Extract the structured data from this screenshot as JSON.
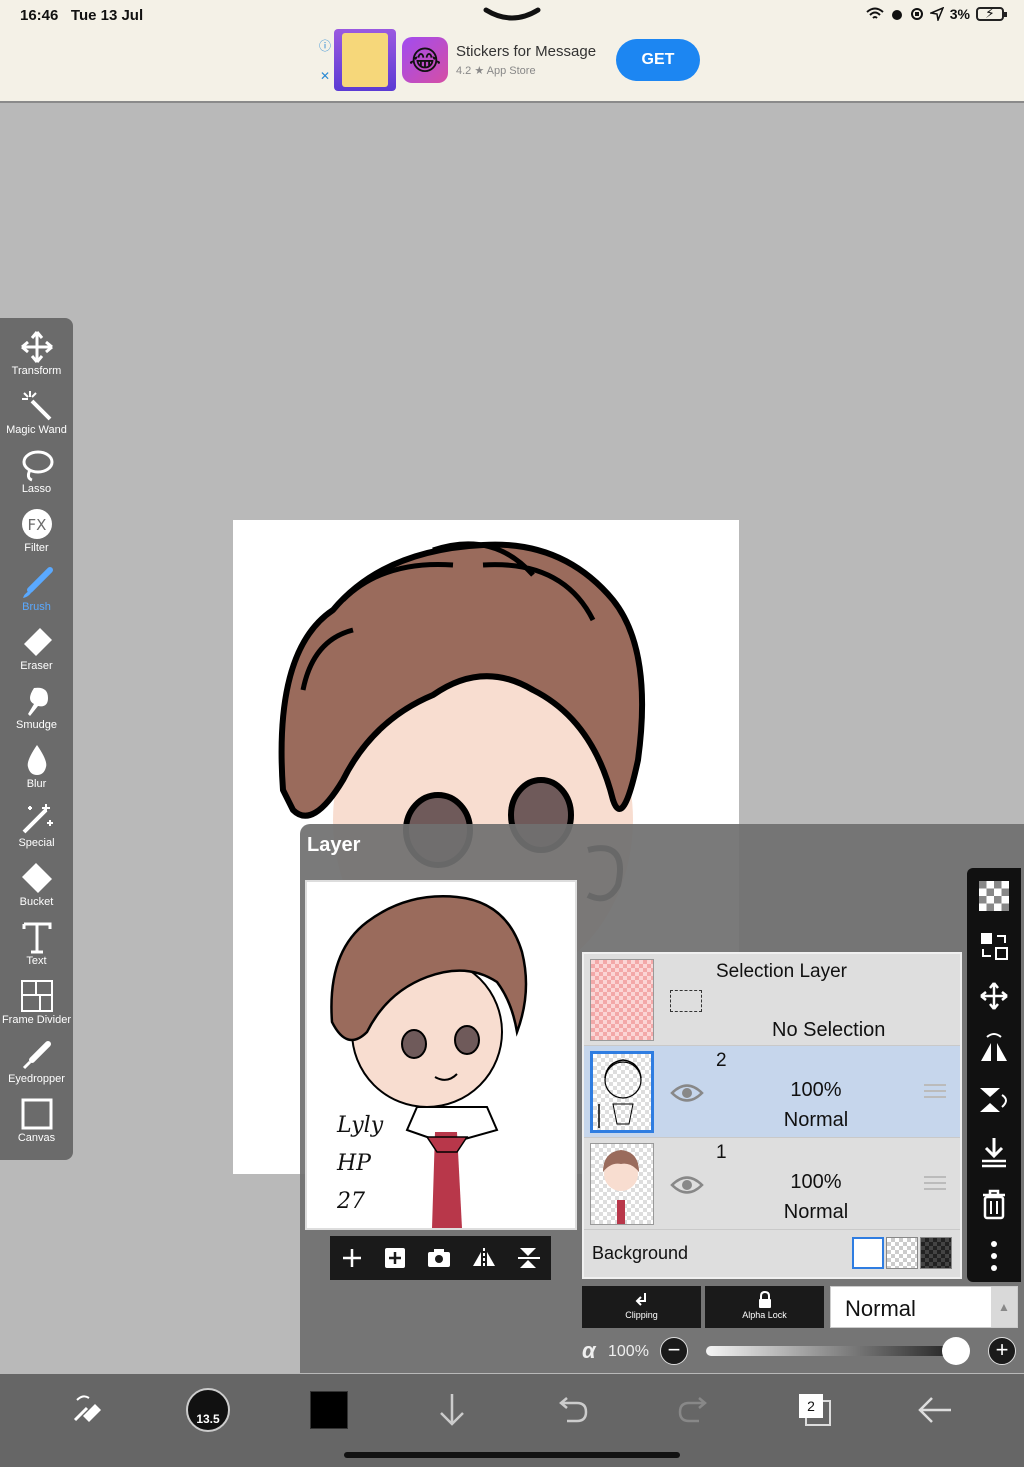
{
  "status": {
    "time": "16:46",
    "date": "Tue 13 Jul",
    "battery": "3%"
  },
  "ad": {
    "title": "Stickers for Message",
    "subtitle": "4.2 ★ App Store",
    "cta": "GET"
  },
  "tools": [
    {
      "id": "transform",
      "label": "Transform",
      "icon": "move-arrows-icon"
    },
    {
      "id": "magic-wand",
      "label": "Magic Wand",
      "icon": "magic-wand-icon"
    },
    {
      "id": "lasso",
      "label": "Lasso",
      "icon": "lasso-icon"
    },
    {
      "id": "filter",
      "label": "Filter",
      "icon": "fx-icon"
    },
    {
      "id": "brush",
      "label": "Brush",
      "icon": "brush-icon",
      "active": true
    },
    {
      "id": "eraser",
      "label": "Eraser",
      "icon": "eraser-icon"
    },
    {
      "id": "smudge",
      "label": "Smudge",
      "icon": "smudge-icon"
    },
    {
      "id": "blur",
      "label": "Blur",
      "icon": "drop-icon"
    },
    {
      "id": "special",
      "label": "Special",
      "icon": "sparkle-icon"
    },
    {
      "id": "bucket",
      "label": "Bucket",
      "icon": "bucket-icon"
    },
    {
      "id": "text",
      "label": "Text",
      "icon": "text-icon"
    },
    {
      "id": "frame-divider",
      "label": "Frame Divider",
      "icon": "frame-divider-icon"
    },
    {
      "id": "eyedropper",
      "label": "Eyedropper",
      "icon": "eyedropper-icon"
    },
    {
      "id": "canvas",
      "label": "Canvas",
      "icon": "canvas-icon"
    }
  ],
  "layer_panel": {
    "title": "Layer",
    "preview_text": [
      "Lyly",
      "HP",
      "27"
    ],
    "selection_layer": {
      "name": "Selection Layer",
      "status": "No Selection"
    },
    "layers": [
      {
        "name": "2",
        "opacity": "100%",
        "mode": "Normal",
        "selected": true
      },
      {
        "name": "1",
        "opacity": "100%",
        "mode": "Normal",
        "selected": false
      }
    ],
    "background_label": "Background",
    "clipping_label": "Clipping",
    "alpha_lock_label": "Alpha Lock",
    "blend_mode": "Normal",
    "alpha_symbol": "α",
    "alpha_value": "100%",
    "alpha_fraction": 1.0
  },
  "bottom_bar": {
    "brush_size": "13.5",
    "layer_count": "2"
  },
  "colors": {
    "hair": "#9a6b5c",
    "skin": "#f8ddd0",
    "accent": "#2f7de1",
    "primary_color": "#000000",
    "ribbon": "#b8374a"
  }
}
